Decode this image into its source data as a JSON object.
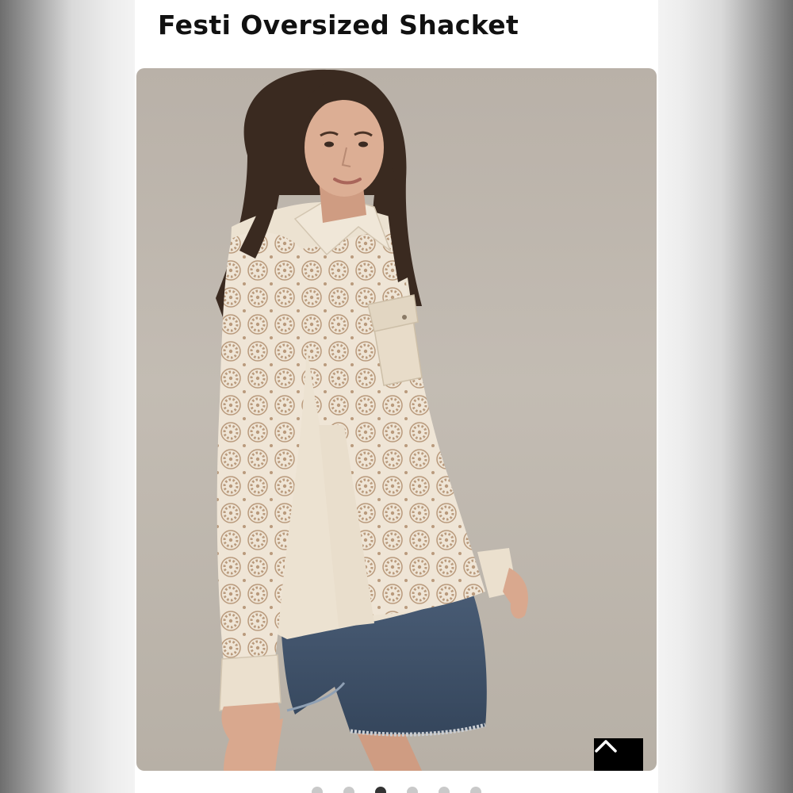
{
  "product": {
    "title": "Festi Oversized Shacket"
  },
  "image": {
    "subject": "product-photo",
    "colors": {
      "background": "#bdb5ab",
      "shirt": "#ece2d1",
      "lace": "#efe5d6",
      "shorts": "#3f5169",
      "hair": "#3a2a20",
      "skin": "#d9a88e"
    }
  },
  "controls": {
    "back_to_top_icon": "chevron-up-icon"
  },
  "carousel": {
    "count": 6,
    "active_index": 2
  },
  "colors": {
    "page_bg": "#f3f3f3",
    "frame_bg": "#ffffff",
    "title_text": "#111111",
    "button_bg": "#000000",
    "dot_inactive": "#c9c9c9",
    "dot_active": "#333333"
  }
}
